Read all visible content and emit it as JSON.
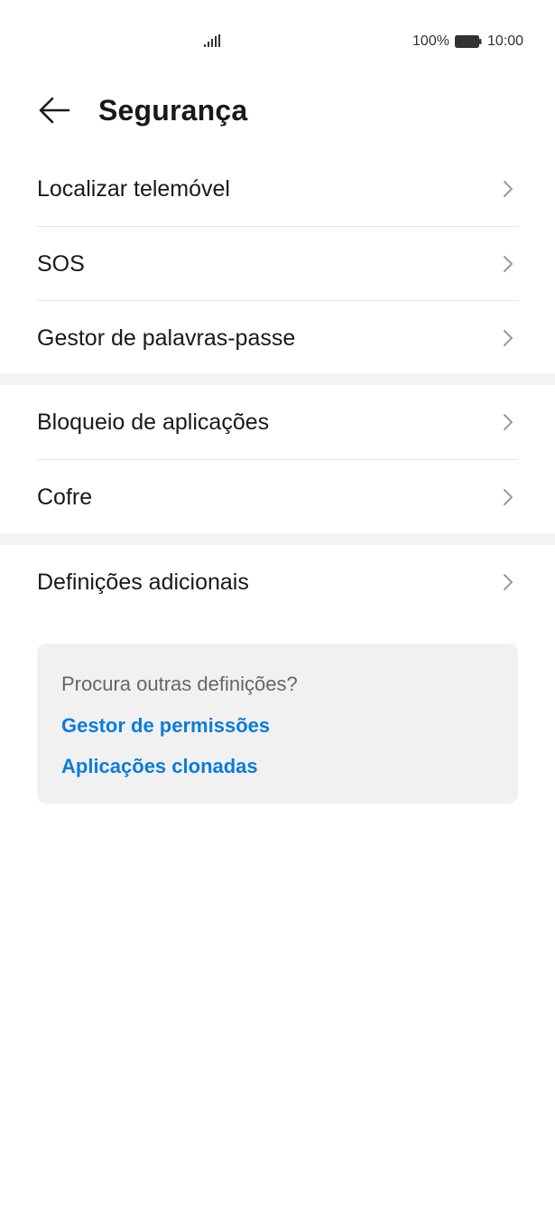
{
  "status_bar": {
    "battery_percent": "100%",
    "time": "10:00"
  },
  "header": {
    "title": "Segurança",
    "back_icon": "arrow-left-icon"
  },
  "groups": [
    {
      "items": [
        {
          "label": "Localizar telemóvel"
        },
        {
          "label": "SOS"
        },
        {
          "label": "Gestor de palavras-passe"
        }
      ]
    },
    {
      "items": [
        {
          "label": "Bloqueio de aplicações"
        },
        {
          "label": "Cofre"
        }
      ]
    },
    {
      "items": [
        {
          "label": "Definições adicionais"
        }
      ]
    }
  ],
  "suggestions": {
    "title": "Procura outras definições?",
    "links": [
      {
        "label": "Gestor de permissões"
      },
      {
        "label": "Aplicações clonadas"
      }
    ]
  },
  "colors": {
    "link": "#0a7cdc",
    "divider_band": "#f1f3f5",
    "card_bg": "#f1f1f1"
  }
}
